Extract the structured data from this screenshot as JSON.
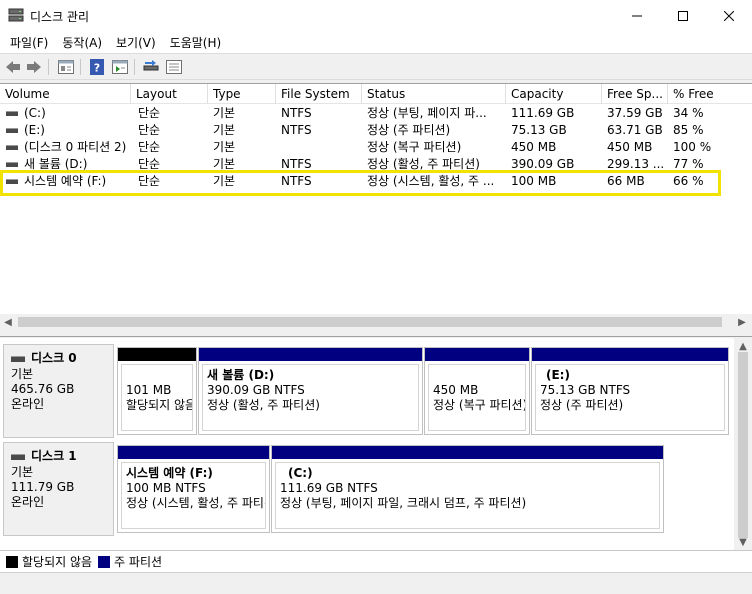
{
  "window": {
    "title": "디스크 관리",
    "minimize_icon": "minimize-icon",
    "maximize_icon": "maximize-icon",
    "close_icon": "close-icon"
  },
  "menu": [
    "파일(F)",
    "동작(A)",
    "보기(V)",
    "도움말(H)"
  ],
  "toolbar": [
    "back-arrow-icon",
    "forward-arrow-icon",
    "properties-icon",
    "help-icon",
    "console-tree-icon",
    "rescan-disk-icon",
    "view-icon"
  ],
  "columns": [
    "Volume",
    "Layout",
    "Type",
    "File System",
    "Status",
    "Capacity",
    "Free Sp...",
    "% Free"
  ],
  "volumes": [
    {
      "volume": "(C:)",
      "layout": "단순",
      "type": "기본",
      "fs": "NTFS",
      "status": "정상 (부팅, 페이지 파...",
      "capacity": "111.69 GB",
      "free": "37.59 GB",
      "pct": "34 %"
    },
    {
      "volume": "(E:)",
      "layout": "단순",
      "type": "기본",
      "fs": "NTFS",
      "status": "정상 (주 파티션)",
      "capacity": "75.13 GB",
      "free": "63.71 GB",
      "pct": "85 %"
    },
    {
      "volume": "(디스크 0 파티션 2)",
      "layout": "단순",
      "type": "기본",
      "fs": "",
      "status": "정상 (복구 파티션)",
      "capacity": "450 MB",
      "free": "450 MB",
      "pct": "100 %"
    },
    {
      "volume": "새 볼륨 (D:)",
      "layout": "단순",
      "type": "기본",
      "fs": "NTFS",
      "status": "정상 (활성, 주 파티션)",
      "capacity": "390.09 GB",
      "free": "299.13 ...",
      "pct": "77 %"
    },
    {
      "volume": "시스템 예약 (F:)",
      "layout": "단순",
      "type": "기본",
      "fs": "NTFS",
      "status": "정상 (시스템, 활성, 주 ...",
      "capacity": "100 MB",
      "free": "66 MB",
      "pct": "66 %"
    }
  ],
  "disks": [
    {
      "name": "디스크 0",
      "type": "기본",
      "size": "465.76 GB",
      "state": "온라인",
      "partitions": [
        {
          "name": "",
          "size": "101 MB",
          "status": "할당되지 않음",
          "kind": "unallocated"
        },
        {
          "name": "새 볼륨  (D:)",
          "size": "390.09 GB NTFS",
          "status": "정상 (활성, 주 파티션)",
          "kind": "primary"
        },
        {
          "name": "",
          "size": "450 MB",
          "status": "정상 (복구 파티션)",
          "kind": "primary"
        },
        {
          "name": "(E:)",
          "size": "75.13 GB NTFS",
          "status": "정상 (주 파티션)",
          "kind": "primary"
        }
      ]
    },
    {
      "name": "디스크 1",
      "type": "기본",
      "size": "111.79 GB",
      "state": "온라인",
      "partitions": [
        {
          "name": "시스템 예약  (F:)",
          "size": "100 MB NTFS",
          "status": "정상 (시스템, 활성, 주 파티션)",
          "kind": "primary"
        },
        {
          "name": "(C:)",
          "size": "111.69 GB NTFS",
          "status": "정상 (부팅, 페이지 파일, 크래시 덤프, 주 파티션)",
          "kind": "primary"
        }
      ]
    }
  ],
  "legend": [
    {
      "label": "할당되지 않음",
      "color": "#000000"
    },
    {
      "label": "주 파티션",
      "color": "#000080"
    }
  ],
  "colors": {
    "primary": "#000080",
    "unallocated": "#000000",
    "highlight": "#f2e200"
  }
}
